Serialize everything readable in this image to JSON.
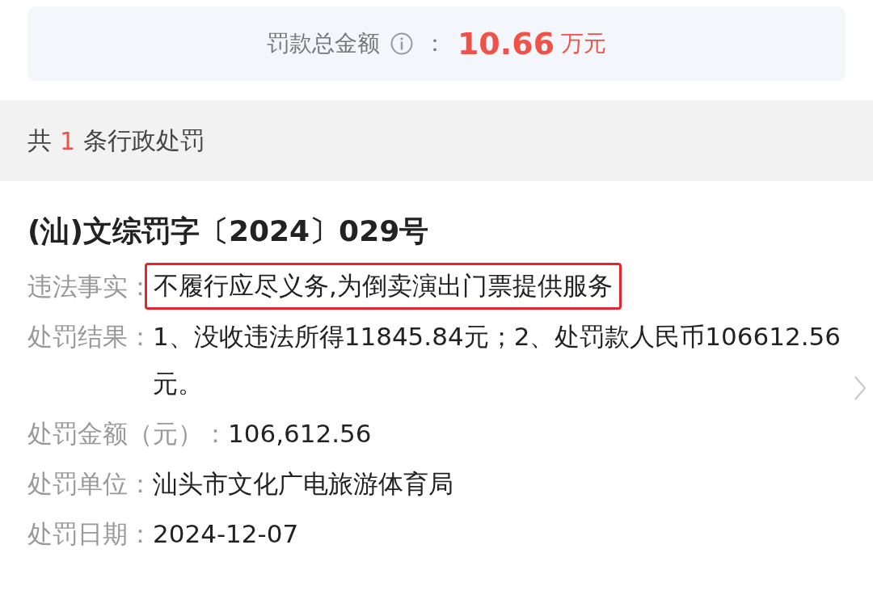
{
  "summary": {
    "label": "罚款总金额",
    "separator": "：",
    "amount": "10.66",
    "unit": "万元"
  },
  "count_bar": {
    "prefix": "共",
    "count": "1",
    "suffix": "条行政处罚"
  },
  "record": {
    "title": "(汕)文综罚字〔2024〕029号",
    "fields": [
      {
        "label": "违法事实：",
        "value": "不履行应尽义务,为倒卖演出门票提供服务",
        "highlighted": true
      },
      {
        "label": "处罚结果：",
        "value": "1、没收违法所得11845.84元；2、处罚款人民币106612.56元。",
        "highlighted": false
      },
      {
        "label": "处罚金额（元）：",
        "value": "106,612.56",
        "highlighted": false
      },
      {
        "label": "处罚单位：",
        "value": "汕头市文化广电旅游体育局",
        "highlighted": false
      },
      {
        "label": "处罚日期：",
        "value": "2024-12-07",
        "highlighted": false
      }
    ]
  }
}
